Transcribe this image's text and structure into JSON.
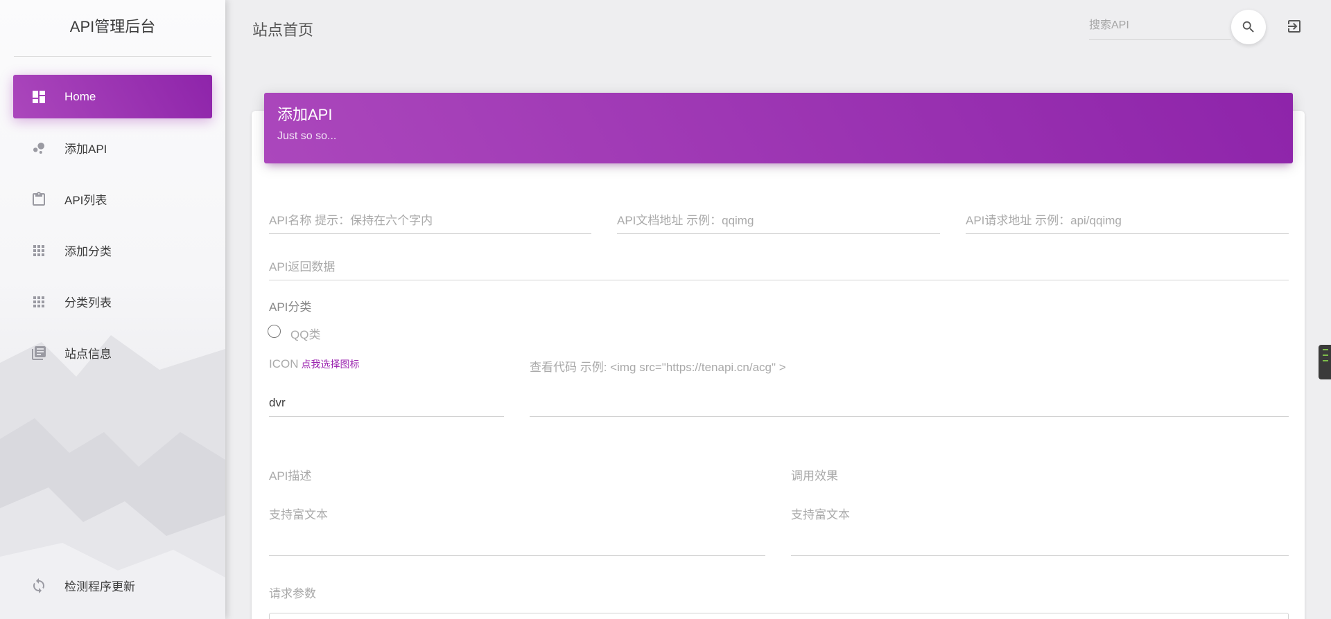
{
  "app": {
    "brand": "API管理后台",
    "page_title": "站点首页"
  },
  "sidebar": {
    "items": [
      {
        "label": "Home",
        "icon": "dashboard-icon",
        "active": true
      },
      {
        "label": "添加API",
        "icon": "bubble-chart-icon",
        "active": false
      },
      {
        "label": "API列表",
        "icon": "clipboard-icon",
        "active": false
      },
      {
        "label": "添加分类",
        "icon": "apps-icon",
        "active": false
      },
      {
        "label": "分类列表",
        "icon": "apps-icon",
        "active": false
      },
      {
        "label": "站点信息",
        "icon": "library-books-icon",
        "active": false
      }
    ],
    "bottom": {
      "label": "检测程序更新",
      "icon": "refresh-icon"
    }
  },
  "topbar": {
    "search_placeholder": "搜索API"
  },
  "card": {
    "title": "添加API",
    "subtitle": "Just so so..."
  },
  "form": {
    "api_name_placeholder": "API名称 提示：保持在六个字内",
    "doc_url_placeholder": "API文档地址 示例：qqimg",
    "request_url_placeholder": "API请求地址 示例：api/qqimg",
    "return_data_placeholder": "API返回数据",
    "category_label": "API分类",
    "category_option": "QQ类",
    "icon_label": "ICON",
    "icon_link": "点我选择图标",
    "icon_value": "dvr",
    "code_label": "查看代码 示例: <img src=\"https://tenapi.cn/acg\" >",
    "desc_label": "API描述",
    "desc_placeholder": "支持富文本",
    "effect_label": "调用效果",
    "effect_placeholder": "支持富文本",
    "params_label": "请求参数"
  },
  "colors": {
    "accent": "#9c27b0",
    "accent_light": "#ab47bc",
    "accent_dark": "#8e24aa"
  }
}
